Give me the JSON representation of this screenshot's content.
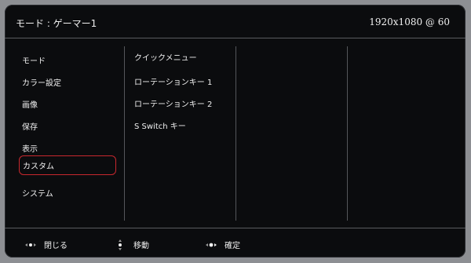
{
  "header": {
    "mode": "モード : ゲーマー1",
    "resolution": "1920x1080 @ 60"
  },
  "sidebar": {
    "items": [
      {
        "label": "モード"
      },
      {
        "label": "カラー設定"
      },
      {
        "label": "画像"
      },
      {
        "label": "保存"
      },
      {
        "label": "表示"
      },
      {
        "label": "カスタム",
        "selected": true
      },
      {
        "label": "システム"
      }
    ]
  },
  "submenu": {
    "items": [
      {
        "label": "クイックメニュー"
      },
      {
        "label": "ローテーションキー 1"
      },
      {
        "label": "ローテーションキー 2"
      },
      {
        "label": "S Switch キー"
      }
    ]
  },
  "footer": {
    "close_label": "閉じる",
    "move_label": "移動",
    "confirm_label": "確定"
  },
  "colors": {
    "selection": "#c8282e",
    "background": "#0b0c0e"
  }
}
